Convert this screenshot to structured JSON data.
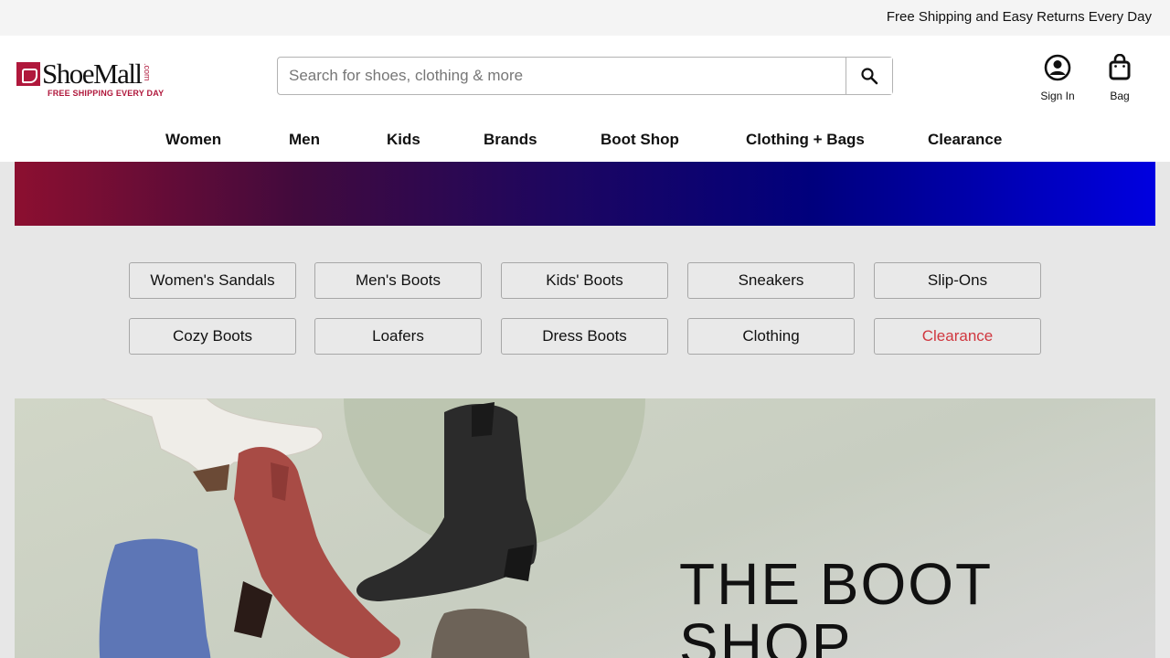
{
  "topbar": {
    "message": "Free Shipping and Easy Returns Every Day"
  },
  "header": {
    "logo_name": "ShoeMall",
    "logo_suffix": ".com",
    "logo_tagline": "FREE SHIPPING EVERY DAY",
    "search": {
      "placeholder": "Search for shoes, clothing & more",
      "value": ""
    },
    "account_label": "Sign In",
    "bag_label": "Bag",
    "icons": {
      "search": "search-icon",
      "account": "user-circle-icon",
      "bag": "shopping-bag-icon"
    }
  },
  "nav": {
    "items": [
      {
        "label": "Women"
      },
      {
        "label": "Men"
      },
      {
        "label": "Kids"
      },
      {
        "label": "Brands"
      },
      {
        "label": "Boot Shop"
      },
      {
        "label": "Clothing + Bags"
      },
      {
        "label": "Clearance"
      }
    ]
  },
  "categories": {
    "row1": [
      {
        "label": "Women's Sandals"
      },
      {
        "label": "Men's Boots"
      },
      {
        "label": "Kids' Boots"
      },
      {
        "label": "Sneakers"
      },
      {
        "label": "Slip-Ons"
      }
    ],
    "row2": [
      {
        "label": "Cozy Boots"
      },
      {
        "label": "Loafers"
      },
      {
        "label": "Dress Boots"
      },
      {
        "label": "Clothing"
      },
      {
        "label": "Clearance"
      }
    ]
  },
  "hero": {
    "title_line1": "THE BOOT",
    "title_line2": "SHOP"
  },
  "colors": {
    "brand": "#b0183c",
    "sale": "#d0373f",
    "banner_start": "#8c0f30",
    "banner_end": "#0000e0"
  }
}
